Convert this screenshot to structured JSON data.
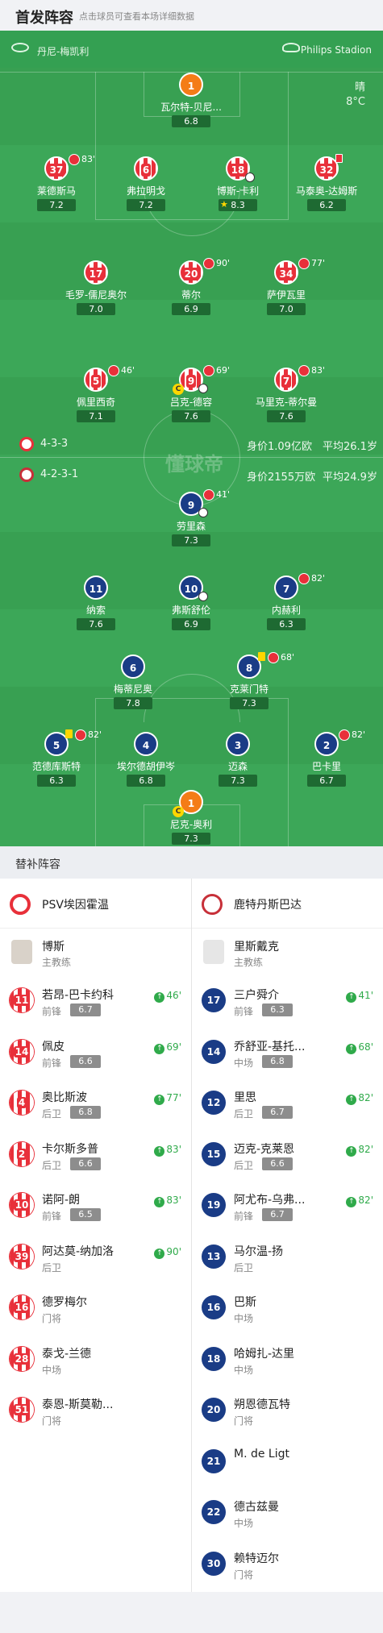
{
  "header": {
    "title": "首发阵容",
    "subtitle": "点击球员可查看本场详细数据"
  },
  "teambar": {
    "left": "丹尼-梅凯利",
    "right": "Philips Stadion"
  },
  "weather": {
    "condition": "晴",
    "temp": "8°C"
  },
  "home_form": {
    "formation": "4-3-3",
    "value": "身价1.09亿欧",
    "age": "平均26.1岁"
  },
  "away_form": {
    "formation": "4-2-3-1",
    "value": "身价2155万欧",
    "age": "平均24.9岁"
  },
  "watermark": "懂球帝",
  "home_players": [
    {
      "num": "1",
      "name": "瓦尔特-贝尼...",
      "rating": "6.8"
    },
    {
      "num": "37",
      "name": "莱德斯马",
      "rating": "7.2",
      "sub": "83'"
    },
    {
      "num": "6",
      "name": "弗拉明戈",
      "rating": "7.2"
    },
    {
      "num": "18",
      "name": "博斯-卡利",
      "rating": "8.3"
    },
    {
      "num": "32",
      "name": "马泰奥-达姆斯",
      "rating": "6.2"
    },
    {
      "num": "17",
      "name": "毛罗-儒尼奥尔",
      "rating": "7.0"
    },
    {
      "num": "20",
      "name": "蒂尔",
      "rating": "6.9",
      "sub": "90'"
    },
    {
      "num": "34",
      "name": "萨伊瓦里",
      "rating": "7.0",
      "sub": "77'"
    },
    {
      "num": "5",
      "name": "佩里西奇",
      "rating": "7.1",
      "sub": "46'"
    },
    {
      "num": "9",
      "name": "吕克-德容",
      "rating": "7.6",
      "sub": "69'"
    },
    {
      "num": "7",
      "name": "马里克-蒂尔曼",
      "rating": "7.6",
      "sub": "83'"
    }
  ],
  "away_players": [
    {
      "num": "9",
      "name": "劳里森",
      "rating": "7.3",
      "sub": "41'"
    },
    {
      "num": "11",
      "name": "纳索",
      "rating": "7.6"
    },
    {
      "num": "10",
      "name": "弗斯舒伦",
      "rating": "6.9"
    },
    {
      "num": "7",
      "name": "内赫利",
      "rating": "6.3",
      "sub": "82'"
    },
    {
      "num": "6",
      "name": "梅蒂尼奥",
      "rating": "7.8"
    },
    {
      "num": "8",
      "name": "克莱门特",
      "rating": "7.3",
      "sub": "68'"
    },
    {
      "num": "5",
      "name": "范德库斯特",
      "rating": "6.3",
      "sub": "82'"
    },
    {
      "num": "4",
      "name": "埃尔德胡伊岑",
      "rating": "6.8"
    },
    {
      "num": "3",
      "name": "迈森",
      "rating": "7.3"
    },
    {
      "num": "2",
      "name": "巴卡里",
      "rating": "6.7",
      "sub": "82'"
    },
    {
      "num": "1",
      "name": "尼克-奥利",
      "rating": "7.3"
    }
  ],
  "subs": {
    "title": "替补阵容",
    "home_team": "PSV埃因霍温",
    "away_team": "鹿特丹斯巴达",
    "home_coach": {
      "name": "博斯",
      "role": "主教练"
    },
    "away_coach": {
      "name": "里斯戴克",
      "role": "主教练"
    },
    "home": [
      {
        "num": "11",
        "name": "若昂-巴卡约科",
        "pos": "前锋",
        "rating": "6.7",
        "on": "46'"
      },
      {
        "num": "14",
        "name": "佩皮",
        "pos": "前锋",
        "rating": "6.6",
        "on": "69'"
      },
      {
        "num": "4",
        "name": "奥比斯波",
        "pos": "后卫",
        "rating": "6.8",
        "on": "77'"
      },
      {
        "num": "2",
        "name": "卡尔斯多普",
        "pos": "后卫",
        "rating": "6.6",
        "on": "83'"
      },
      {
        "num": "10",
        "name": "诺阿-朗",
        "pos": "前锋",
        "rating": "6.5",
        "on": "83'"
      },
      {
        "num": "39",
        "name": "阿达莫-纳加洛",
        "pos": "后卫",
        "rating": "",
        "on": "90'"
      },
      {
        "num": "16",
        "name": "德罗梅尔",
        "pos": "门将",
        "rating": "",
        "on": ""
      },
      {
        "num": "28",
        "name": "泰戈-兰德",
        "pos": "中场",
        "rating": "",
        "on": ""
      },
      {
        "num": "51",
        "name": "泰恩-斯莫勒...",
        "pos": "门将",
        "rating": "",
        "on": ""
      }
    ],
    "away": [
      {
        "num": "17",
        "name": "三户舜介",
        "pos": "前锋",
        "rating": "6.3",
        "on": "41'"
      },
      {
        "num": "14",
        "name": "乔舒亚-基托...",
        "pos": "中场",
        "rating": "6.8",
        "on": "68'"
      },
      {
        "num": "12",
        "name": "里思",
        "pos": "后卫",
        "rating": "6.7",
        "on": "82'"
      },
      {
        "num": "15",
        "name": "迈克-克莱恩",
        "pos": "后卫",
        "rating": "6.6",
        "on": "82'"
      },
      {
        "num": "19",
        "name": "阿尤布-乌弗...",
        "pos": "前锋",
        "rating": "6.7",
        "on": "82'"
      },
      {
        "num": "13",
        "name": "马尔温-扬",
        "pos": "后卫",
        "rating": "",
        "on": ""
      },
      {
        "num": "16",
        "name": "巴斯",
        "pos": "中场",
        "rating": "",
        "on": ""
      },
      {
        "num": "18",
        "name": "哈姆扎-达里",
        "pos": "中场",
        "rating": "",
        "on": ""
      },
      {
        "num": "20",
        "name": "朔恩德瓦特",
        "pos": "门将",
        "rating": "",
        "on": ""
      },
      {
        "num": "21",
        "name": "M. de Ligt",
        "pos": "",
        "rating": "",
        "on": ""
      },
      {
        "num": "22",
        "name": "德古兹曼",
        "pos": "中场",
        "rating": "",
        "on": ""
      },
      {
        "num": "30",
        "name": "赖特迈尔",
        "pos": "门将",
        "rating": "",
        "on": ""
      }
    ]
  }
}
